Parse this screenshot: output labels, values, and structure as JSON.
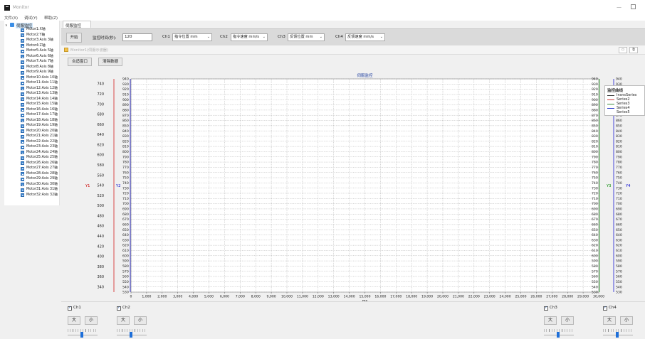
{
  "app": {
    "title": "Monitor"
  },
  "menu": [
    "文件(X)",
    "调试(Y)",
    "帮助(Z)"
  ],
  "tree": {
    "root": "伺服监控",
    "items": [
      "Motor1:X轴",
      "Motor2:Y轴",
      "Motor3:Axis 3轴",
      "Motor4:Z轴",
      "Motor5:Axis 5轴",
      "Motor6:Axis 6轴",
      "Motor7:Axis 7轴",
      "Motor8:Axis 8轴",
      "Motor9:Axis 9轴",
      "Motor10:Axis 10轴",
      "Motor11:Axis 11轴",
      "Motor12:Axis 12轴",
      "Motor13:Axis 13轴",
      "Motor14:Axis 14轴",
      "Motor15:Axis 15轴",
      "Motor16:Axis 16轴",
      "Motor17:Axis 17轴",
      "Motor18:Axis 18轴",
      "Motor19:Axis 19轴",
      "Motor20:Axis 20轴",
      "Motor21:Axis 21轴",
      "Motor22:Axis 22轴",
      "Motor23:Axis 23轴",
      "Motor24:Axis 24轴",
      "Motor25:Axis 25轴",
      "Motor26:Axis 26轴",
      "Motor27:Axis 27轴",
      "Motor28:Axis 28轴",
      "Motor29:Axis 29轴",
      "Motor30:Axis 30轴",
      "Motor31:Axis 31轴",
      "Motor32:Axis 32轴"
    ]
  },
  "tab": {
    "label": "伺服监控"
  },
  "toolbar": {
    "start_label": "开始",
    "interval_label": "监控时间(秒):",
    "interval_value": "120",
    "channels": [
      {
        "label": "Ch1",
        "value": "指令位置 mm"
      },
      {
        "label": "Ch2",
        "value": "指令速度 mm/s"
      },
      {
        "label": "Ch3",
        "value": "反馈位置 mm"
      },
      {
        "label": "Ch4",
        "value": "反馈速度 mm/s"
      }
    ]
  },
  "subwindow": {
    "title": "Monitor1(伺服示波器)",
    "btn_merge": "合适窗口",
    "btn_clear": "清除数据"
  },
  "chart_data": {
    "type": "line",
    "title": "伺服监控",
    "xlabel": "ms",
    "xlim": [
      0,
      30000
    ],
    "x_ticks": [
      0,
      1000,
      2000,
      3000,
      4000,
      5000,
      6000,
      7000,
      8000,
      9000,
      10000,
      11000,
      12000,
      13000,
      14000,
      15000,
      16000,
      17000,
      18000,
      19000,
      20000,
      21000,
      22000,
      23000,
      24000,
      25000,
      26000,
      27000,
      28000,
      29000,
      30000
    ],
    "x_tick_labels": [
      "0",
      "1,000",
      "2,000",
      "3,000",
      "4,000",
      "5,000",
      "6,000",
      "7,000",
      "8,000",
      "9,000",
      "10,000",
      "11,000",
      "12,000",
      "13,000",
      "14,000",
      "15,000",
      "16,000",
      "17,000",
      "18,000",
      "19,000",
      "20,000",
      "21,000",
      "22,000",
      "23,000",
      "24,000",
      "25,000",
      "26,000",
      "27,000",
      "28,000",
      "29,000",
      "30,000"
    ],
    "axes": [
      {
        "name": "Y1",
        "ylim": [
          330,
          750
        ],
        "ticks": [
          340,
          360,
          380,
          400,
          420,
          440,
          460,
          480,
          500,
          520,
          540,
          560,
          580,
          600,
          620,
          640,
          660,
          680,
          700,
          720,
          740
        ],
        "color": "#cc0000"
      },
      {
        "name": "Y2",
        "ylim": [
          530,
          940
        ],
        "ticks": [
          530,
          540,
          550,
          560,
          570,
          580,
          590,
          600,
          610,
          620,
          630,
          640,
          650,
          660,
          670,
          680,
          690,
          700,
          710,
          720,
          730,
          740,
          750,
          760,
          770,
          780,
          790,
          800,
          810,
          820,
          830,
          840,
          850,
          860,
          870,
          880,
          890,
          900,
          910,
          920,
          930,
          940
        ],
        "color": "#0000cc"
      },
      {
        "name": "Y3",
        "ylim": [
          530,
          940
        ],
        "ticks": [
          530,
          540,
          550,
          560,
          570,
          580,
          590,
          600,
          610,
          620,
          630,
          640,
          650,
          660,
          670,
          680,
          690,
          700,
          710,
          720,
          730,
          740,
          750,
          760,
          770,
          780,
          790,
          800,
          810,
          820,
          830,
          840,
          850,
          860,
          870,
          880,
          890,
          900,
          910,
          920,
          930,
          940
        ],
        "color": "#008800"
      },
      {
        "name": "Y4",
        "ylim": [
          530,
          940
        ],
        "ticks": [
          530,
          540,
          550,
          560,
          570,
          580,
          590,
          600,
          610,
          620,
          630,
          640,
          650,
          660,
          670,
          680,
          690,
          700,
          710,
          720,
          730,
          740,
          750,
          760,
          770,
          780,
          790,
          800,
          810,
          820,
          830,
          840,
          850,
          860,
          870,
          880,
          890,
          900,
          910,
          920,
          930,
          940
        ],
        "color": "#0000cc"
      }
    ],
    "grid": true,
    "legend": {
      "title": "监控曲线",
      "position": "right",
      "entries": [
        {
          "name": "InsnsSeries",
          "color": "#333333"
        },
        {
          "name": "Series2",
          "color": "#cc3333"
        },
        {
          "name": "Series3",
          "color": "#3a8a3a"
        },
        {
          "name": "Series4",
          "color": "#3344cc"
        },
        {
          "name": "Series5",
          "color": "#ffffff"
        }
      ]
    },
    "series": []
  },
  "bottom": {
    "channels": [
      "Ch1",
      "Ch2",
      "Ch3",
      "Ch4"
    ],
    "big_label": "大",
    "small_label": "小"
  }
}
